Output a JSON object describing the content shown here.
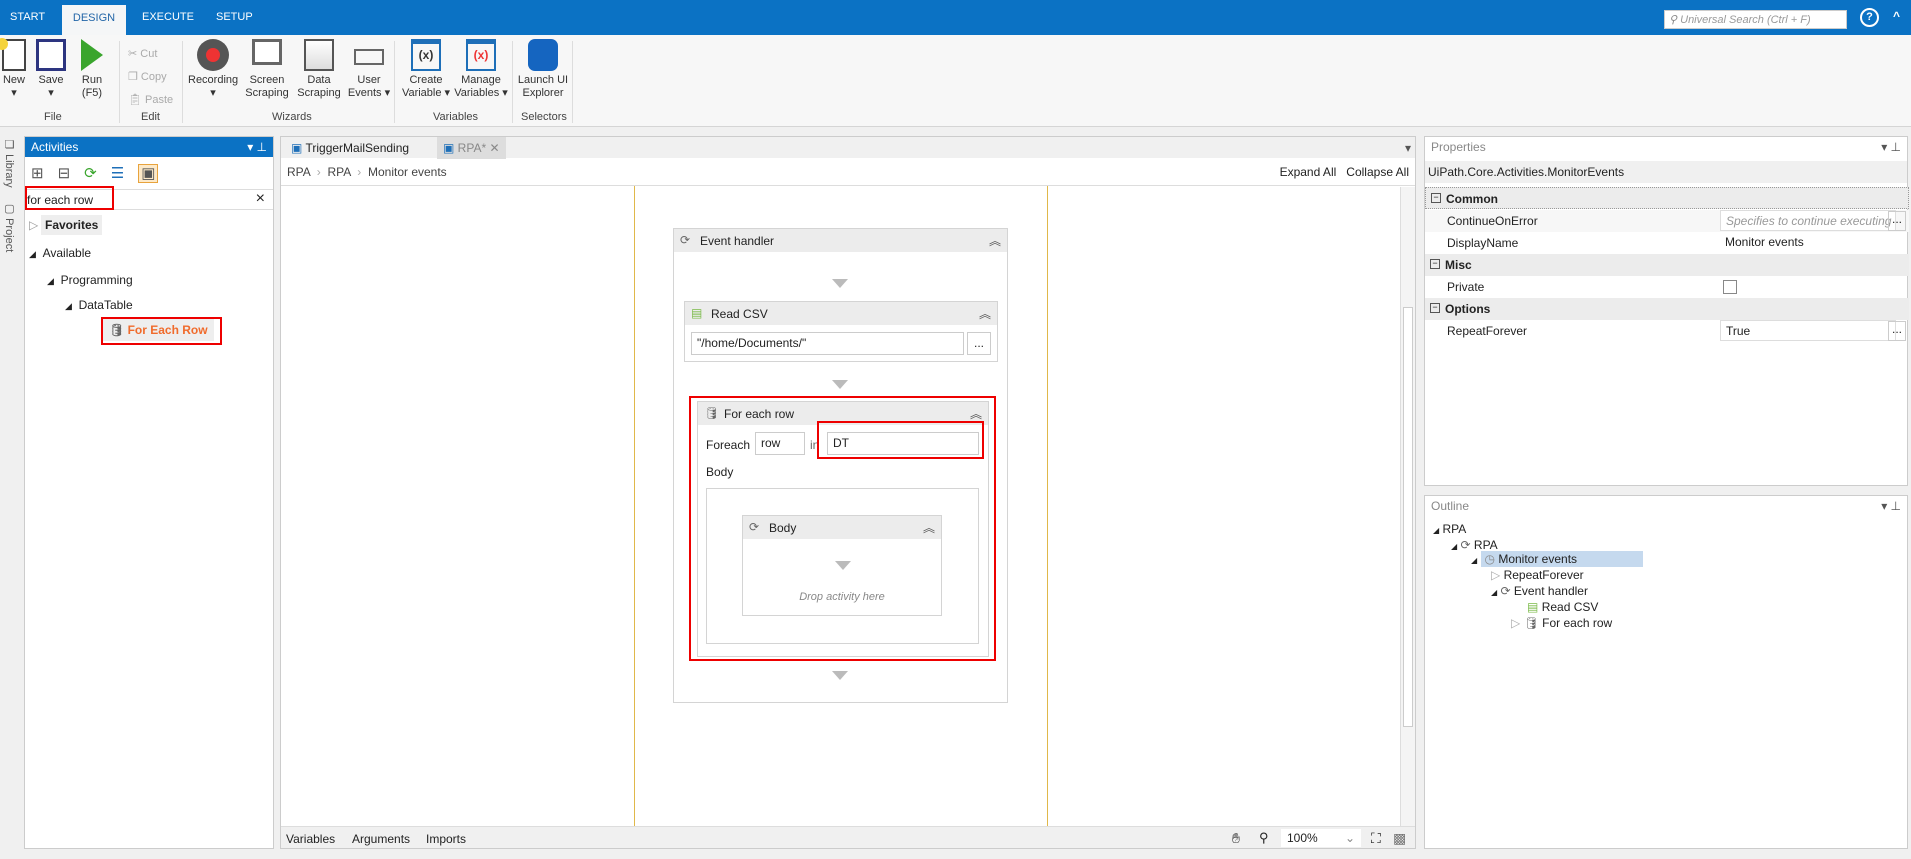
{
  "topbar": {
    "tabs": [
      "START",
      "DESIGN",
      "EXECUTE",
      "SETUP"
    ],
    "search_placeholder": "Universal Search (Ctrl + F)",
    "help": "?",
    "collapse": "^"
  },
  "ribbon": {
    "file": {
      "new": "New",
      "save": "Save",
      "run": "Run",
      "run2": "(F5)",
      "label": "File"
    },
    "edit": {
      "cut": "Cut",
      "copy": "Copy",
      "paste": "Paste",
      "label": "Edit"
    },
    "wizards": {
      "recording": "Recording",
      "screen1": "Screen",
      "screen2": "Scraping",
      "data1": "Data",
      "data2": "Scraping",
      "user1": "User",
      "user2": "Events ▾",
      "label": "Wizards"
    },
    "variables": {
      "create1": "Create",
      "create2": "Variable ▾",
      "manage1": "Manage",
      "manage2": "Variables ▾",
      "label": "Variables",
      "icon_text": "(x)"
    },
    "selectors": {
      "launch1": "Launch UI",
      "launch2": "Explorer",
      "label": "Selectors"
    }
  },
  "side_strip": {
    "library": "Library",
    "project": "Project"
  },
  "activities": {
    "title": "Activities",
    "search_value": "for each row",
    "clear": "×",
    "tree": {
      "favorites": "Favorites",
      "available": "Available",
      "programming": "Programming",
      "datatable": "DataTable",
      "for_each_row": "For Each Row"
    }
  },
  "designer": {
    "tabs": [
      "TriggerMailSending",
      "RPA*"
    ],
    "breadcrumb": [
      "RPA",
      "RPA",
      "Monitor events"
    ],
    "expand_all": "Expand All",
    "collapse_all": "Collapse All",
    "event_handler": "Event handler",
    "read_csv": {
      "title": "Read CSV",
      "path": "\"/home/Documents/\"",
      "browse": "..."
    },
    "for_each": {
      "title": "For each row",
      "foreach_label": "Foreach",
      "item": "row",
      "in_label": "in",
      "collection": "DT",
      "body_label": "Body",
      "body_title": "Body",
      "drop_hint": "Drop activity here"
    },
    "bottom": {
      "variables": "Variables",
      "arguments": "Arguments",
      "imports": "Imports",
      "zoom": "100%"
    }
  },
  "properties": {
    "title": "Properties",
    "type": "UiPath.Core.Activities.MonitorEvents",
    "common": "Common",
    "continue_on_error": "ContinueOnError",
    "continue_placeholder": "Specifies to continue executing",
    "display_name": "DisplayName",
    "display_value": "Monitor events",
    "misc": "Misc",
    "private": "Private",
    "options": "Options",
    "repeat_forever": "RepeatForever",
    "repeat_value": "True",
    "dots": "..."
  },
  "outline": {
    "title": "Outline",
    "items": [
      "RPA",
      "RPA",
      "Monitor events",
      "RepeatForever",
      "Event handler",
      "Read CSV",
      "For each row"
    ]
  }
}
